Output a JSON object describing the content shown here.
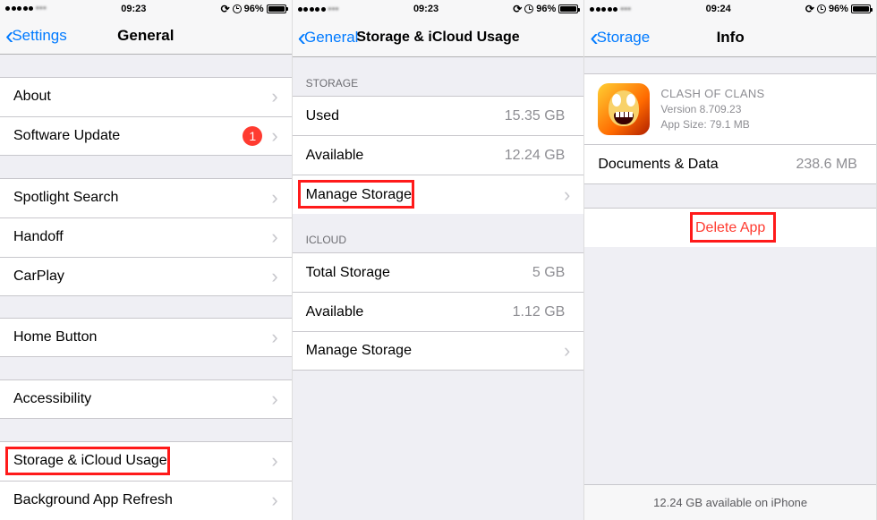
{
  "status": {
    "carrier_blur": "▪▪▪",
    "time1": "09:23",
    "time2": "09:23",
    "time3": "09:24",
    "battery_pct": "96%"
  },
  "screen1": {
    "back_label": "Settings",
    "title": "General",
    "rows": {
      "about": "About",
      "software_update": "Software Update",
      "badge": "1",
      "spotlight": "Spotlight Search",
      "handoff": "Handoff",
      "carplay": "CarPlay",
      "home_button": "Home Button",
      "accessibility": "Accessibility",
      "storage_icloud": "Storage & iCloud Usage",
      "background_refresh": "Background App Refresh"
    }
  },
  "screen2": {
    "back_label": "General",
    "title": "Storage & iCloud Usage",
    "headers": {
      "storage": "Storage",
      "icloud": "iCloud"
    },
    "rows": {
      "used": "Used",
      "used_val": "15.35 GB",
      "available": "Available",
      "available_val": "12.24 GB",
      "manage_storage": "Manage Storage",
      "total_storage": "Total Storage",
      "total_storage_val": "5 GB",
      "icloud_available": "Available",
      "icloud_available_val": "1.12 GB",
      "icloud_manage": "Manage Storage"
    }
  },
  "screen3": {
    "back_label": "Storage",
    "title": "Info",
    "app": {
      "name": "CLASH OF CLANS",
      "version": "Version 8.709.23",
      "size": "App Size: 79.1 MB"
    },
    "rows": {
      "docs": "Documents & Data",
      "docs_val": "238.6 MB",
      "delete": "Delete App"
    },
    "footer": "12.24 GB available on iPhone"
  }
}
